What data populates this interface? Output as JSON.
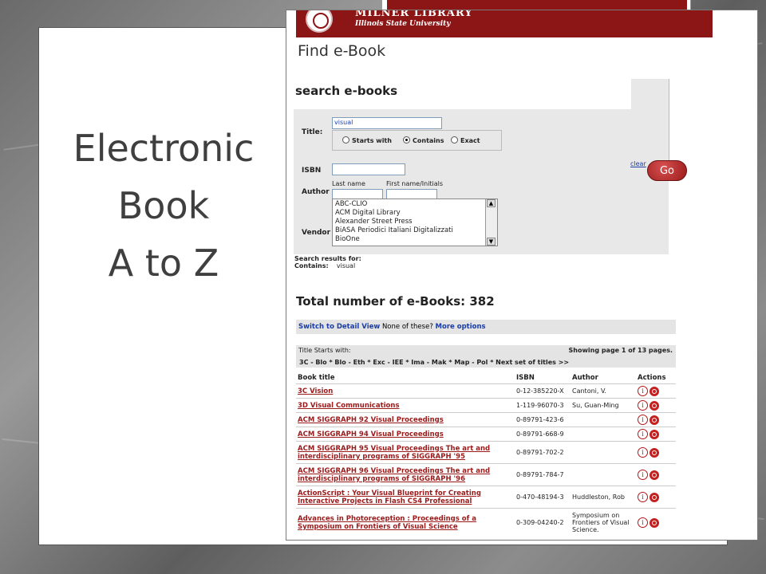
{
  "slide": {
    "title_lines": [
      "Electronic",
      "Book",
      "A to Z"
    ]
  },
  "banner": {
    "title": "MILNER LIBRARY",
    "subtitle": "Illinois State University"
  },
  "page_heading": "Find e-Book",
  "search": {
    "heading": "search e-books",
    "title_label": "Title:",
    "title_value": "visual",
    "radio_options": [
      {
        "label": "Starts with",
        "selected": false
      },
      {
        "label": "Contains",
        "selected": true
      },
      {
        "label": "Exact",
        "selected": false
      }
    ],
    "isbn_label": "ISBN",
    "author_label": "Author",
    "last_name_label": "Last name",
    "first_name_label": "First name/Initials",
    "vendor_label": "Vendor",
    "vendors": [
      "ABC-CLIO",
      "ACM Digital Library",
      "Alexander Street Press",
      "BiASA Periodici Italiani Digitalizzati",
      "BioOne"
    ],
    "clear_label": "clear",
    "go_label": "Go"
  },
  "results": {
    "search_results_for": "Search results for:",
    "contains_label": "Contains:",
    "contains_value": "visual",
    "total": "Total number of e-Books: 382",
    "switch_view": "Switch to Detail View",
    "none_of_these": "None of these?",
    "more_options": "More options",
    "title_starts_with": "Title Starts with:",
    "showing_page": "Showing page 1 of 13 pages.",
    "nav_links": "3C - Blo * Blo - Eth * Exc - IEE * Ima - Mak * Map - Pol * Next set of titles >>",
    "columns": [
      "Book title",
      "ISBN",
      "Author",
      "Actions"
    ],
    "rows": [
      {
        "title": "3C Vision",
        "isbn": "0-12-385220-X",
        "author": "Cantoni, V."
      },
      {
        "title": "3D Visual Communications",
        "isbn": "1-119-96070-3",
        "author": "Su, Guan-Ming"
      },
      {
        "title": "ACM SIGGRAPH 92 Visual Proceedings",
        "isbn": "0-89791-423-6",
        "author": ""
      },
      {
        "title": "ACM SIGGRAPH 94 Visual Proceedings",
        "isbn": "0-89791-668-9",
        "author": ""
      },
      {
        "title": "ACM SIGGRAPH 95 Visual Proceedings The art and interdisciplinary programs of SIGGRAPH '95",
        "isbn": "0-89791-702-2",
        "author": ""
      },
      {
        "title": "ACM SIGGRAPH 96 Visual Proceedings The art and interdisciplinary programs of SIGGRAPH '96",
        "isbn": "0-89791-784-7",
        "author": ""
      },
      {
        "title": "ActionScript : Your Visual Blueprint for Creating Interactive Projects in Flash CS4 Professional",
        "isbn": "0-470-48194-3",
        "author": "Huddleston, Rob"
      },
      {
        "title": "Advances in Photoreception : Proceedings of a Symposium on Frontiers of Visual Science",
        "isbn": "0-309-04240-2",
        "author": "Symposium on Frontiers of Visual Science."
      }
    ]
  },
  "colors": {
    "brand_red": "#8c1515",
    "link_red": "#9b1a1a",
    "link_blue": "#1a3da8",
    "slide_text": "#3f3f3f"
  },
  "icons": [
    "info-icon",
    "go-icon",
    "university-seal-icon",
    "scroll-up-icon",
    "scroll-down-icon"
  ]
}
